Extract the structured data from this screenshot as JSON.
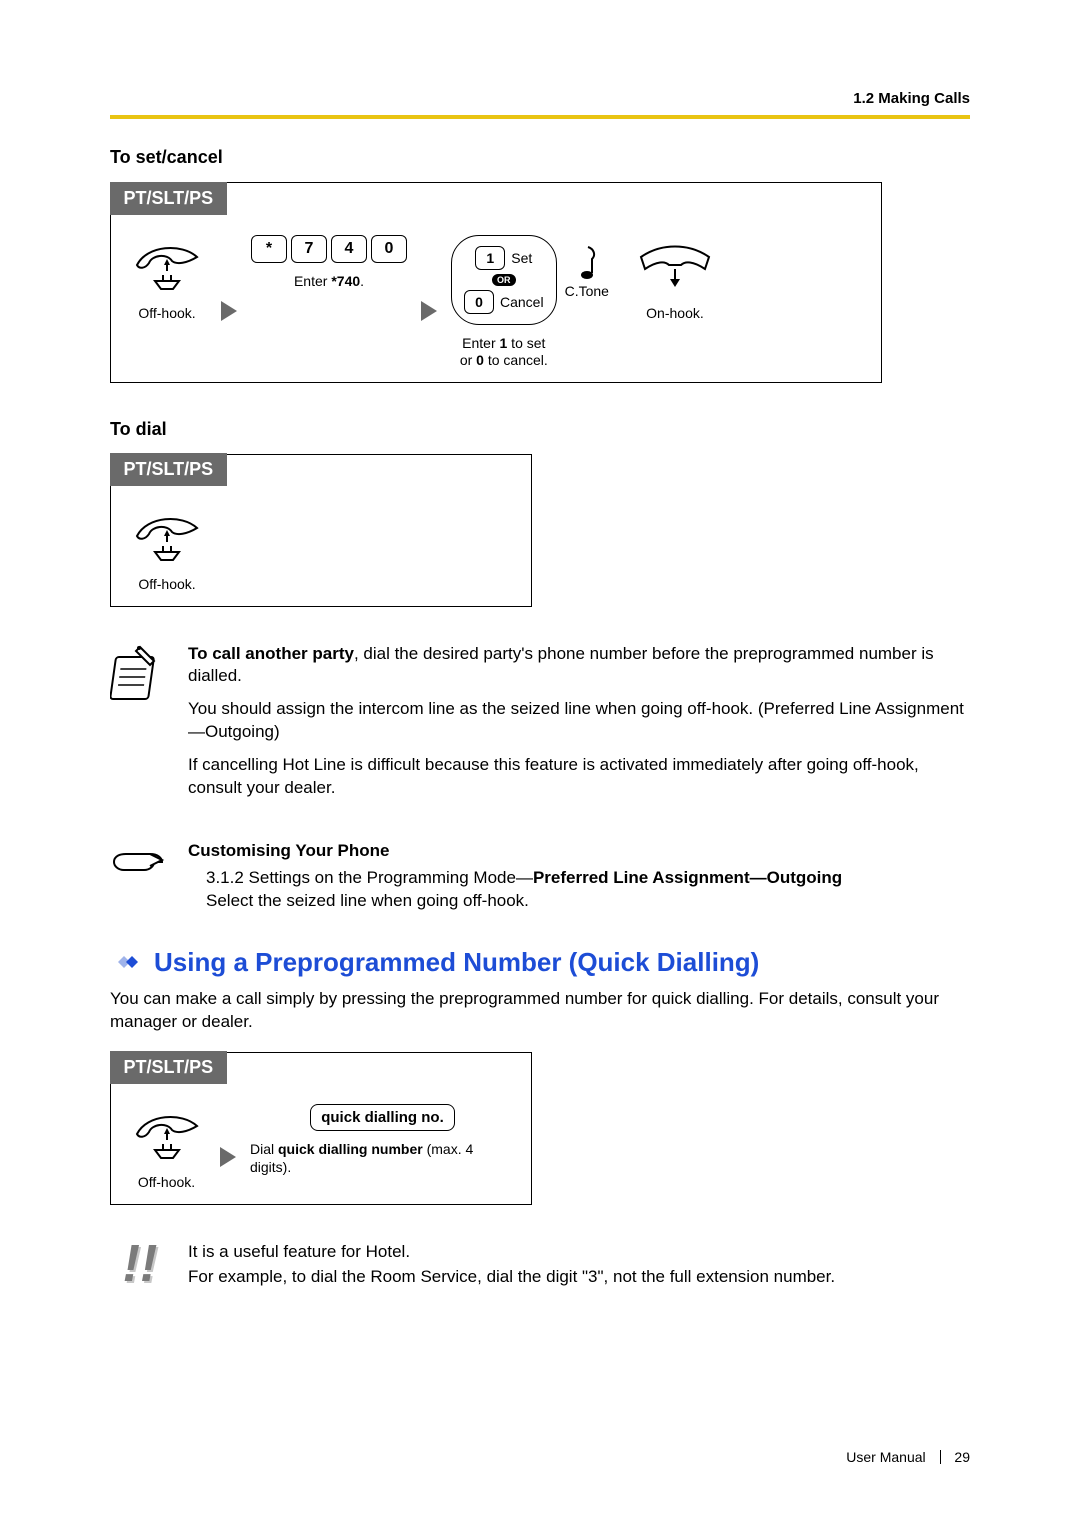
{
  "header": {
    "section": "1.2 Making Calls"
  },
  "setcancel": {
    "title": "To set/cancel",
    "tab": "PT/SLT/PS",
    "offhook_caption": "Off-hook.",
    "keys": [
      "*",
      "7",
      "4",
      "0"
    ],
    "enter_caption_prefix": "Enter ",
    "enter_caption_code": "*740",
    "enter_caption_suffix": ".",
    "choice_set_key": "1",
    "choice_set_label": "Set",
    "or_label": "OR",
    "choice_cancel_key": "0",
    "choice_cancel_label": "Cancel",
    "choice_caption_l1a": "Enter ",
    "choice_caption_l1b": "1",
    "choice_caption_l1c": " to set",
    "choice_caption_l2a": "or ",
    "choice_caption_l2b": "0",
    "choice_caption_l2c": " to cancel.",
    "ctone_label": "C.Tone",
    "onhook_caption": "On-hook."
  },
  "dial": {
    "title": "To dial",
    "tab": "PT/SLT/PS",
    "offhook_caption": "Off-hook."
  },
  "notes": {
    "p1_lead": "To call another party",
    "p1_rest": ", dial the desired party's phone number before the preprogrammed number is dialled.",
    "p2": "You should assign the intercom line as the seized line when going off-hook. (Preferred Line Assignment—Outgoing)",
    "p3": "If cancelling Hot Line is difficult because this feature is activated immediately after going off-hook, consult your dealer."
  },
  "customising": {
    "title": "Customising Your Phone",
    "line_prefix": "3.1.2 Settings on the Programming Mode—",
    "line_bold": "Preferred Line Assignment—Outgoing",
    "line2": "Select the seized line when going off-hook."
  },
  "quickdial": {
    "heading": "Using a Preprogrammed Number (Quick Dialling)",
    "intro": "You can make a call simply by pressing the preprogrammed number for quick dialling. For details, consult your manager or dealer.",
    "tab": "PT/SLT/PS",
    "offhook_caption": "Off-hook.",
    "keytext": "quick dialling no.",
    "dial_caption_prefix": "Dial ",
    "dial_caption_bold": "quick dialling number",
    "dial_caption_suffix": " (max. 4 digits)."
  },
  "exclaim": {
    "l1": "It is a useful feature for Hotel.",
    "l2": "For example, to dial the Room Service, dial the digit \"3\", not the full extension number."
  },
  "footer": {
    "label": "User Manual",
    "page": "29"
  }
}
